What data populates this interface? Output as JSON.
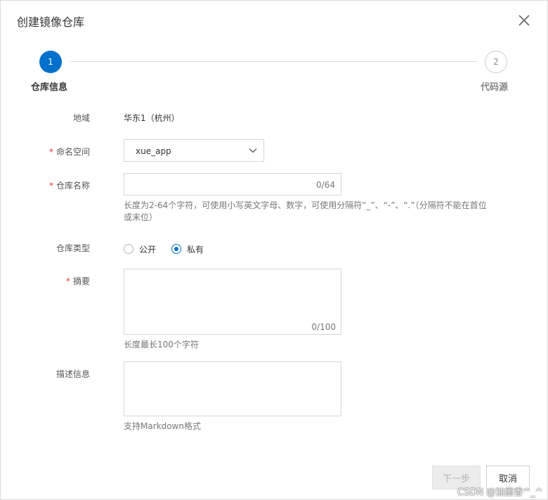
{
  "dialog": {
    "title": "创建镜像仓库",
    "close_icon": "close-icon"
  },
  "steps": [
    {
      "number": "1",
      "label": "仓库信息",
      "active": true
    },
    {
      "number": "2",
      "label": "代码源",
      "active": false
    }
  ],
  "form": {
    "region": {
      "label": "地域",
      "value": "华东1（杭州）"
    },
    "namespace": {
      "required_mark": "*",
      "label": "命名空间",
      "value": "xue_app",
      "icon": "chevron-down-icon"
    },
    "repo_name": {
      "required_mark": "*",
      "label": "仓库名称",
      "value": "",
      "counter": "0/64",
      "help_line1": "长度为2-64个字符，可使用小写英文字母、数字，可使用分隔符“_”、“-”、“.”（分隔符不能在首位",
      "help_line2": "或末位）"
    },
    "repo_type": {
      "label": "仓库类型",
      "options": [
        {
          "label": "公开",
          "checked": false
        },
        {
          "label": "私有",
          "checked": true
        }
      ]
    },
    "summary": {
      "required_mark": "*",
      "label": "摘要",
      "value": "",
      "counter": "0/100",
      "help": "长度最长100个字符"
    },
    "description": {
      "label": "描述信息",
      "value": "",
      "help": "支持Markdown格式"
    }
  },
  "footer": {
    "next_label": "下一步",
    "cancel_label": "取消"
  },
  "watermark": "CSDN @油墨香^_^",
  "colors": {
    "primary": "#0070cc",
    "required": "#e4393c",
    "border": "#d6d6d6",
    "muted": "#777777"
  }
}
